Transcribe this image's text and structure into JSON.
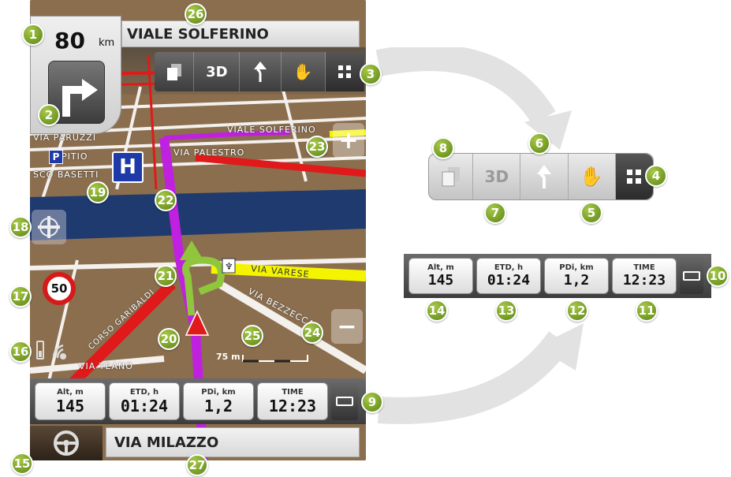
{
  "top_street": "VIALE SOLFERINO",
  "bottom_street": "VIA MILAZZO",
  "speed": {
    "value": "80",
    "unit": "km"
  },
  "speed_limit": "50",
  "scale_label": "75 m",
  "toolbar": {
    "mode_3d": "3D"
  },
  "info": [
    {
      "label": "Alt, m",
      "value": "145"
    },
    {
      "label": "ETD, h",
      "value": "01:24"
    },
    {
      "label": "PDi, km",
      "value": "1,2"
    },
    {
      "label": "TIME",
      "value": "12:23"
    }
  ],
  "map_labels": {
    "viale_solferino": "VIALE SOLFERINO",
    "via_palestro": "VIA PALESTRO",
    "via_varese": "VIA VARESE",
    "via_bezzecca": "VIA BEZZECCA",
    "via_teano": "VIA TEANO",
    "via_paruzzi": "VIA PARUZZI",
    "corso_garibaldi": "CORSO GARIBALDI",
    "brescia": "SCO BASETTI",
    "pitio": "PITIO"
  },
  "poi": {
    "parking": "P",
    "hospital": "H"
  },
  "callouts": [
    "1",
    "2",
    "3",
    "4",
    "5",
    "6",
    "7",
    "8",
    "9",
    "10",
    "11",
    "12",
    "13",
    "14",
    "15",
    "16",
    "17",
    "18",
    "19",
    "20",
    "21",
    "22",
    "23",
    "24",
    "25",
    "26",
    "27"
  ],
  "colors": {
    "badge": "#7da32a",
    "route": "#c020e0",
    "arrow": "#8fc63d",
    "road_red": "#e01a1a",
    "road_yellow": "#f4f400",
    "river": "#1e3a6e",
    "ground": "#8b6e4e"
  },
  "icons": [
    "turn-right-arrow-icon",
    "layers-icon",
    "route-icon",
    "hand-icon",
    "grid-icon",
    "zoom-in-icon",
    "zoom-out-icon",
    "compass-icon",
    "battery-icon",
    "gps-signal-icon",
    "steering-wheel-icon",
    "position-arrow-icon",
    "restaurant-icon"
  ]
}
